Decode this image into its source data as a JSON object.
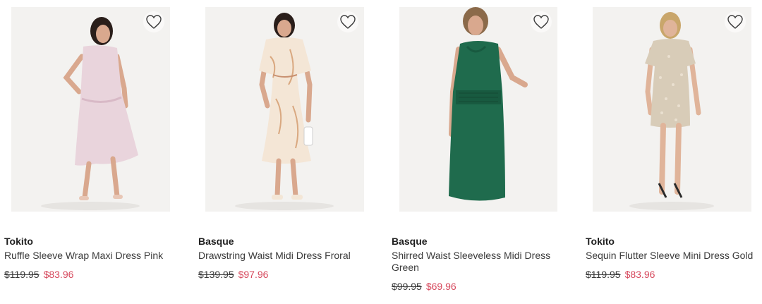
{
  "products": [
    {
      "brand": "Tokito",
      "title": "Ruffle Sleeve Wrap Maxi Dress Pink",
      "was_price": "$119.95",
      "now_price": "$83.96",
      "dress_color": "#e9d4dc"
    },
    {
      "brand": "Basque",
      "title": "Drawstring Waist Midi Dress Froral",
      "was_price": "$139.95",
      "now_price": "$97.96",
      "dress_color": "#f4e6d6"
    },
    {
      "brand": "Basque",
      "title": "Shirred Waist Sleeveless Midi Dress Green",
      "was_price": "$99.95",
      "now_price": "$69.96",
      "dress_color": "#1f6b4d"
    },
    {
      "brand": "Tokito",
      "title": "Sequin Flutter Sleeve Mini Dress Gold",
      "was_price": "$119.95",
      "now_price": "$83.96",
      "dress_color": "#d8ccb8"
    }
  ],
  "icons": {
    "wishlist": "heart-outline-icon"
  },
  "colors": {
    "sale_price": "#d6485c",
    "image_bg": "#f3f2f0"
  }
}
